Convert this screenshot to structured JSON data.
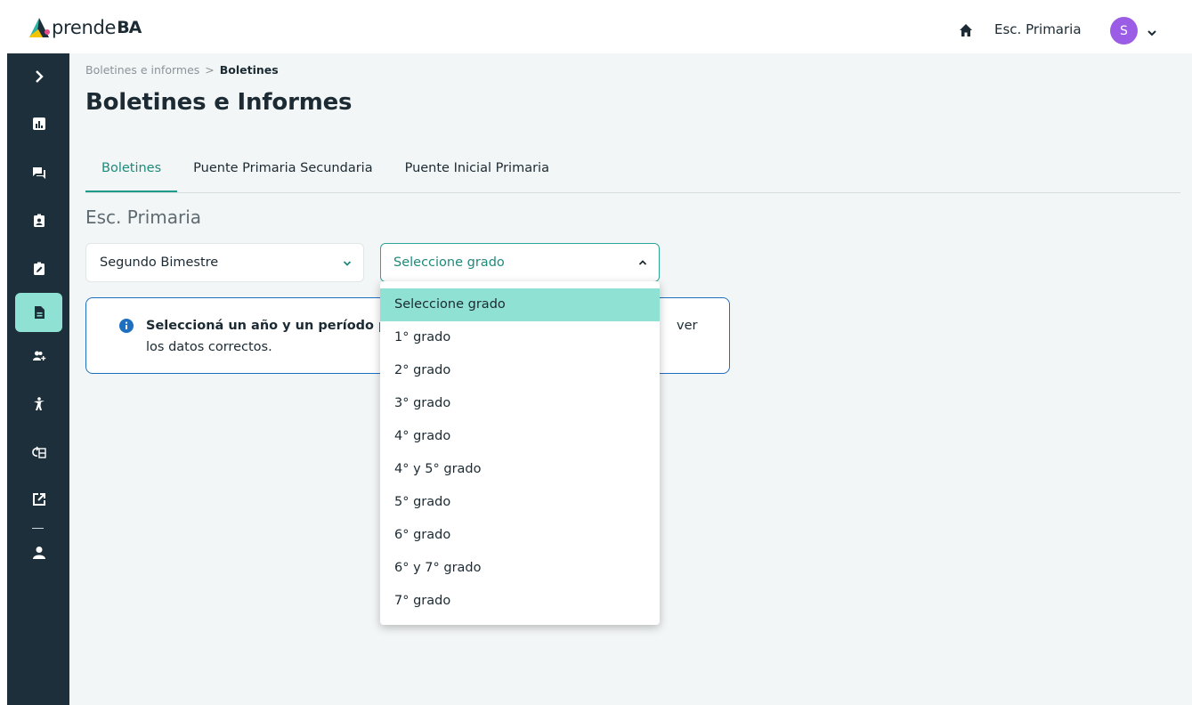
{
  "header": {
    "logo_text": "prende",
    "logo_suffix": "BA",
    "school": "Esc. Primaria",
    "avatar_initial": "S"
  },
  "breadcrumb": {
    "parent": "Boletines e informes",
    "separator": ">",
    "current": "Boletines"
  },
  "page": {
    "title": "Boletines e Informes",
    "section_title": "Esc. Primaria"
  },
  "tabs": [
    {
      "label": "Boletines"
    },
    {
      "label": "Puente Primaria Secundaria"
    },
    {
      "label": "Puente Inicial Primaria"
    }
  ],
  "filters": {
    "period_value": "Segundo Bimestre",
    "grade_value": "Seleccione grado"
  },
  "info": {
    "bold_text": "Seleccioná un año y un período p",
    "tail_text": "ver",
    "second_line": "los datos correctos."
  },
  "dropdown": {
    "options": [
      {
        "label": "Seleccione grado"
      },
      {
        "label": "1° grado"
      },
      {
        "label": "2° grado"
      },
      {
        "label": "3° grado"
      },
      {
        "label": "4° grado"
      },
      {
        "label": "4° y 5° grado"
      },
      {
        "label": "5° grado"
      },
      {
        "label": "6° grado"
      },
      {
        "label": "6° y 7° grado"
      },
      {
        "label": "7° grado"
      }
    ]
  },
  "colors": {
    "sidebar": "#1d2f3a",
    "accent": "#1e9b8a",
    "highlight": "#8fe1d4",
    "info_border": "#1f6fc1",
    "avatar": "#9b5de5"
  },
  "sidebar": {
    "icons": [
      "chevron-right-icon",
      "chart-icon",
      "chat-icon",
      "badge-icon",
      "clipboard-edit-icon",
      "document-icon",
      "add-users-icon",
      "person-running-icon",
      "checklist-icon",
      "external-link-icon",
      "user-icon"
    ]
  }
}
